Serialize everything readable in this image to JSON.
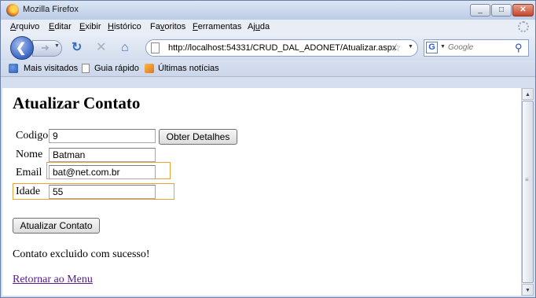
{
  "window": {
    "title": "Mozilla Firefox",
    "controls": {
      "minimize": "_",
      "maximize": "□",
      "close": "✕"
    }
  },
  "menu": {
    "items": [
      {
        "key": "A",
        "rest": "rquivo"
      },
      {
        "key": "E",
        "rest": "ditar"
      },
      {
        "key": "E",
        "rest": "xibir",
        "pre": ""
      },
      {
        "key": "H",
        "rest": "istórico"
      },
      {
        "pre": "Fa",
        "key": "v",
        "rest": "oritos"
      },
      {
        "key": "F",
        "rest": "erramentas"
      },
      {
        "pre": "Aj",
        "key": "u",
        "rest": "da"
      }
    ]
  },
  "nav": {
    "url": "http://localhost:54331/CRUD_DAL_ADONET/Atualizar.aspx",
    "search_placeholder": "Google",
    "search_engine": "G",
    "icons": {
      "back": "back-arrow-icon",
      "forward": "forward-arrow-icon",
      "reload": "reload-icon",
      "stop": "stop-icon",
      "home": "home-icon",
      "bookmark": "star-icon",
      "search": "magnifier-icon"
    }
  },
  "bookmarks": {
    "items": [
      "Mais visitados",
      "Guia rápido",
      "Últimas notícias"
    ]
  },
  "form": {
    "page_title": "Atualizar Contato",
    "codigo_label": "Codigo",
    "codigo_value": "9",
    "obter_button": "Obter Detalhes",
    "nome_label": "Nome",
    "nome_value": "Batman",
    "email_label": "Email",
    "email_value": "bat@net.com.br",
    "idade_label": "Idade",
    "idade_value": "55",
    "atualizar_button": "Atualizar Contato",
    "message": "Contato excluido com sucesso!",
    "return_link": "Retornar ao Menu"
  },
  "colors": {
    "focus_border": "#e8a23c",
    "visited_link": "#551a8b"
  }
}
